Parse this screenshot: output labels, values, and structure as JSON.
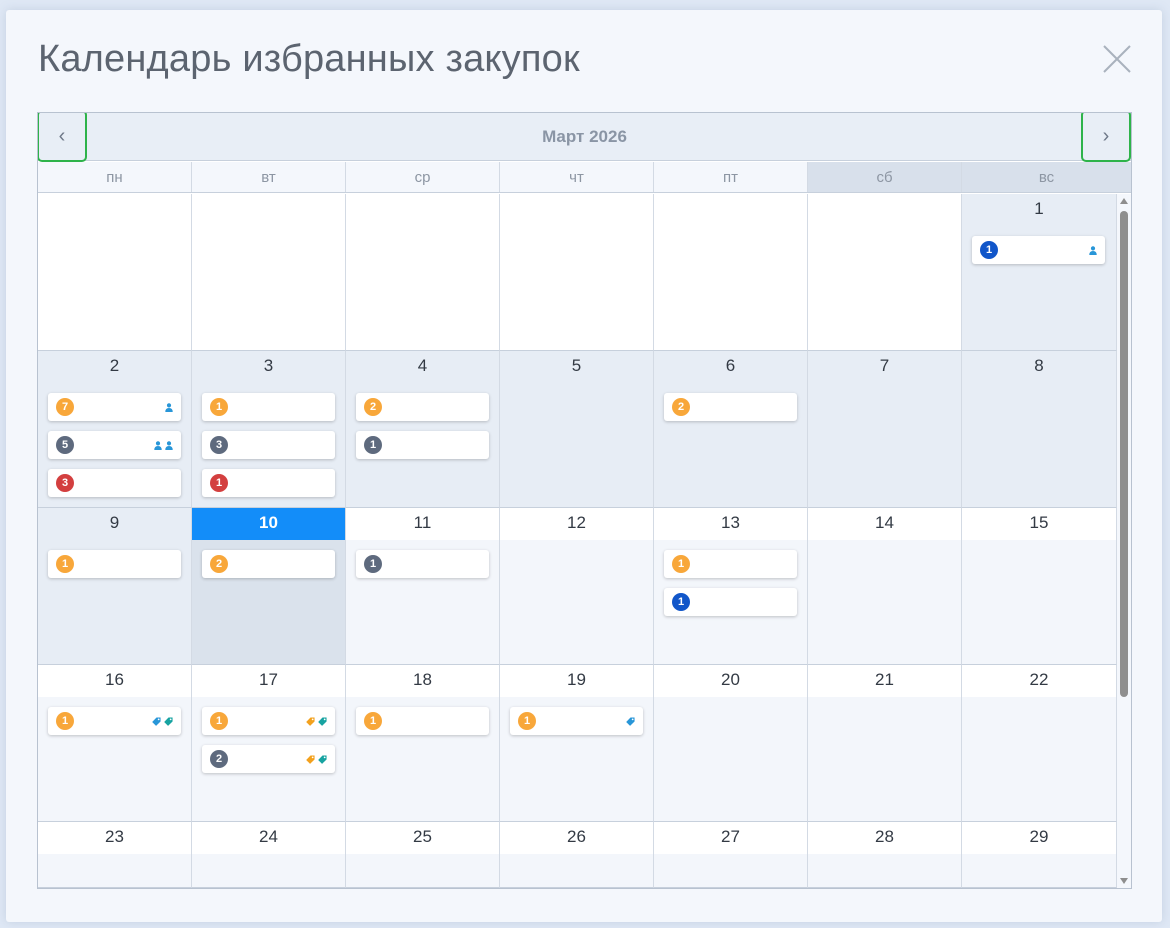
{
  "title": "Календарь избранных закупок",
  "month_label": "Март 2026",
  "prev_label": "‹",
  "next_label": "›",
  "colors": {
    "orange": "#f8a73a",
    "gray": "#5e6a7e",
    "blue": "#1156c9",
    "red": "#d33f3f",
    "today": "#138df9",
    "icon_blue": "#2896d8",
    "icon_teal": "#17a3a1",
    "icon_orange": "#f3a11d"
  },
  "weekdays": [
    "пн",
    "вт",
    "ср",
    "чт",
    "пт",
    "сб",
    "вс"
  ],
  "weeks": [
    [
      {
        "day": "",
        "style": "white",
        "events": []
      },
      {
        "day": "",
        "style": "white",
        "events": []
      },
      {
        "day": "",
        "style": "white",
        "events": []
      },
      {
        "day": "",
        "style": "white",
        "events": []
      },
      {
        "day": "",
        "style": "white",
        "events": []
      },
      {
        "day": "",
        "style": "white",
        "events": []
      },
      {
        "day": "1",
        "style": "shaded",
        "events": [
          {
            "count": "1",
            "color": "blue",
            "icons": [
              "person-icon"
            ]
          }
        ]
      }
    ],
    [
      {
        "day": "2",
        "style": "shaded",
        "events": [
          {
            "count": "7",
            "color": "orange",
            "icons": [
              "person-icon"
            ]
          },
          {
            "count": "5",
            "color": "gray",
            "icons": [
              "person-icon",
              "person-icon"
            ]
          },
          {
            "count": "3",
            "color": "red",
            "icons": []
          }
        ]
      },
      {
        "day": "3",
        "style": "shaded",
        "events": [
          {
            "count": "1",
            "color": "orange",
            "icons": []
          },
          {
            "count": "3",
            "color": "gray",
            "icons": []
          },
          {
            "count": "1",
            "color": "red",
            "icons": []
          }
        ]
      },
      {
        "day": "4",
        "style": "shaded",
        "events": [
          {
            "count": "2",
            "color": "orange",
            "icons": []
          },
          {
            "count": "1",
            "color": "gray",
            "icons": []
          }
        ]
      },
      {
        "day": "5",
        "style": "shaded",
        "events": []
      },
      {
        "day": "6",
        "style": "shaded",
        "events": [
          {
            "count": "2",
            "color": "orange",
            "icons": []
          }
        ]
      },
      {
        "day": "7",
        "style": "shaded",
        "events": []
      },
      {
        "day": "8",
        "style": "shaded",
        "events": []
      }
    ],
    [
      {
        "day": "9",
        "style": "shaded",
        "events": [
          {
            "count": "1",
            "color": "orange",
            "icons": []
          }
        ]
      },
      {
        "day": "10",
        "style": "today",
        "events": [
          {
            "count": "2",
            "color": "orange",
            "icons": []
          }
        ]
      },
      {
        "day": "11",
        "style": "light",
        "events": [
          {
            "count": "1",
            "color": "gray",
            "icons": []
          }
        ]
      },
      {
        "day": "12",
        "style": "light",
        "events": []
      },
      {
        "day": "13",
        "style": "light",
        "events": [
          {
            "count": "1",
            "color": "orange",
            "icons": []
          },
          {
            "count": "1",
            "color": "blue",
            "icons": []
          }
        ]
      },
      {
        "day": "14",
        "style": "light",
        "events": []
      },
      {
        "day": "15",
        "style": "light",
        "events": []
      }
    ],
    [
      {
        "day": "16",
        "style": "light",
        "events": [
          {
            "count": "1",
            "color": "orange",
            "icons": [
              "tag-blue-icon",
              "tag-teal-icon"
            ]
          }
        ]
      },
      {
        "day": "17",
        "style": "light",
        "events": [
          {
            "count": "1",
            "color": "orange",
            "icons": [
              "tag-orange-icon",
              "tag-teal-icon"
            ]
          },
          {
            "count": "2",
            "color": "gray",
            "icons": [
              "tag-orange-icon",
              "tag-teal-icon"
            ]
          }
        ]
      },
      {
        "day": "18",
        "style": "light",
        "events": [
          {
            "count": "1",
            "color": "orange",
            "icons": []
          }
        ]
      },
      {
        "day": "19",
        "style": "light",
        "events": [
          {
            "count": "1",
            "color": "orange",
            "icons": [
              "tag-blue-icon"
            ]
          }
        ]
      },
      {
        "day": "20",
        "style": "light",
        "events": []
      },
      {
        "day": "21",
        "style": "light",
        "events": []
      },
      {
        "day": "22",
        "style": "light",
        "events": []
      }
    ],
    [
      {
        "day": "23",
        "style": "light",
        "events": []
      },
      {
        "day": "24",
        "style": "light",
        "events": []
      },
      {
        "day": "25",
        "style": "light",
        "events": []
      },
      {
        "day": "26",
        "style": "light",
        "events": []
      },
      {
        "day": "27",
        "style": "light",
        "events": []
      },
      {
        "day": "28",
        "style": "light",
        "events": []
      },
      {
        "day": "29",
        "style": "light",
        "events": []
      }
    ]
  ]
}
